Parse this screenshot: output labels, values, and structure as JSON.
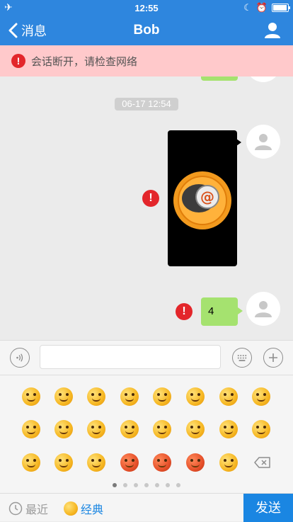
{
  "status_bar": {
    "time": "12:55"
  },
  "nav": {
    "back_label": "消息",
    "title": "Bob"
  },
  "alert": {
    "text": "会话断开，请检查网络"
  },
  "chat": {
    "timestamp": "06-17 12:54",
    "messages": [
      {
        "type": "image",
        "status": "failed"
      },
      {
        "type": "text",
        "text": "4",
        "status": "failed"
      }
    ]
  },
  "input": {
    "value": "",
    "placeholder": ""
  },
  "emoji_pager": {
    "pages": 7,
    "active": 0
  },
  "bottom_tabs": {
    "recent": "最近",
    "classic": "经典",
    "send": "发送"
  },
  "colors": {
    "accent": "#2e86de",
    "alert_bg": "#ffc9cb",
    "bubble": "#a5e26f",
    "error": "#e3262b",
    "send": "#1a86e2"
  }
}
